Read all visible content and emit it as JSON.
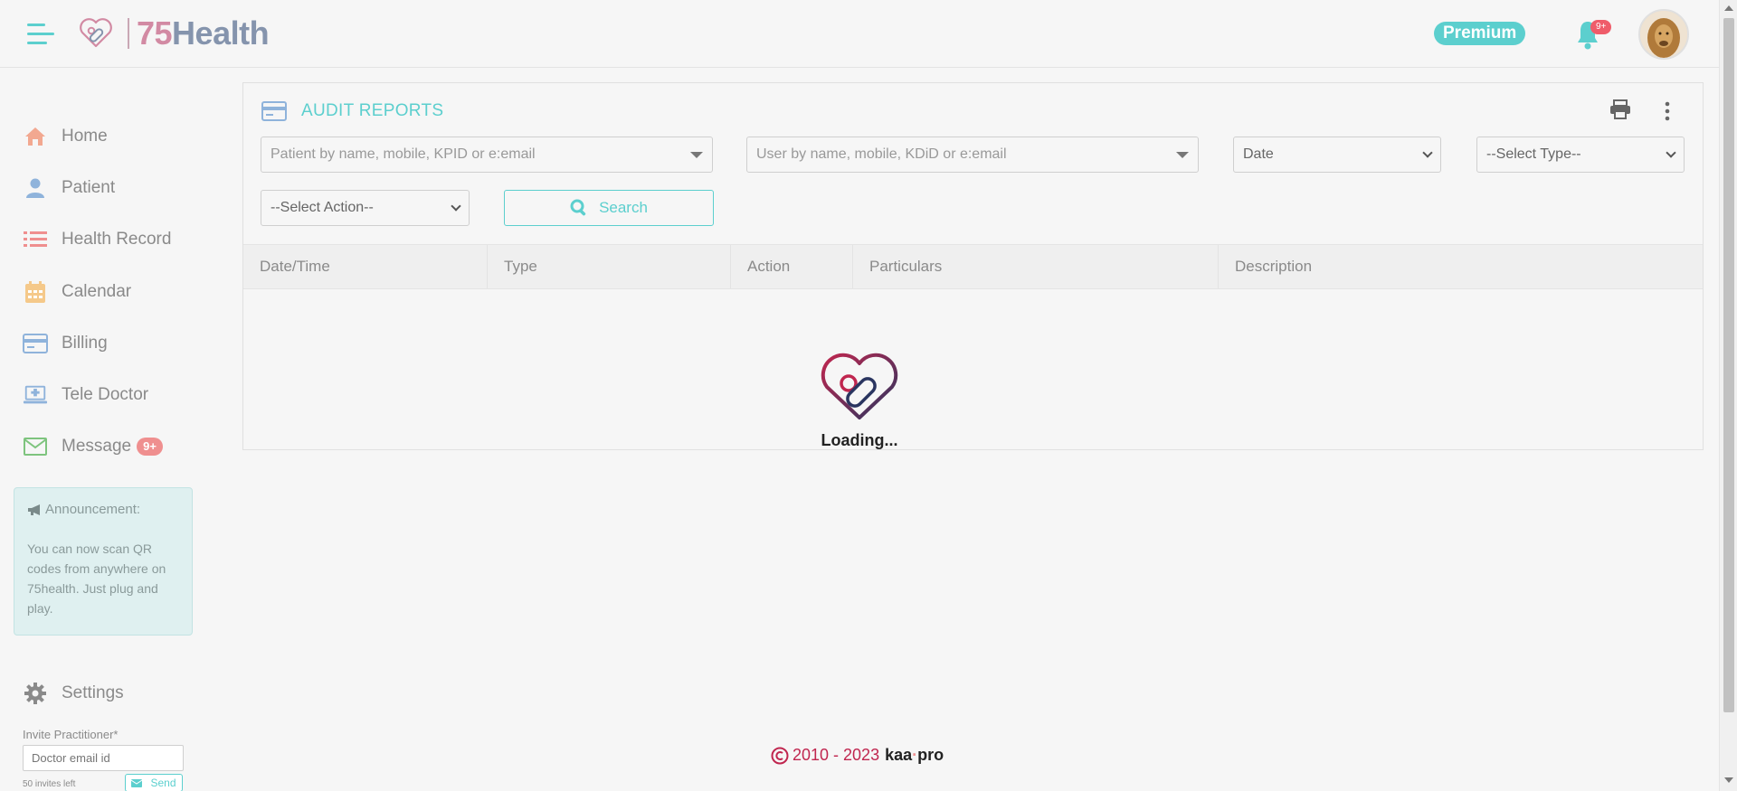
{
  "header": {
    "logo_number": "75",
    "logo_word": "Health",
    "premium_label": "Premium",
    "notification_badge": "9+"
  },
  "sidebar": {
    "items": [
      {
        "label": "Home",
        "icon": "home-icon"
      },
      {
        "label": "Patient",
        "icon": "user-icon"
      },
      {
        "label": "Health Record",
        "icon": "list-icon"
      },
      {
        "label": "Calendar",
        "icon": "calendar-icon"
      },
      {
        "label": "Billing",
        "icon": "credit-card-icon"
      },
      {
        "label": "Tele Doctor",
        "icon": "laptop-medical-icon"
      },
      {
        "label": "Message",
        "icon": "envelope-icon"
      }
    ],
    "message_badge": "9+",
    "announcement": {
      "title": "Announcement:",
      "body": "You can now scan QR codes from anywhere on 75health. Just plug and play."
    },
    "settings_label": "Settings",
    "invite": {
      "label": "Invite Practitioner*",
      "placeholder": "Doctor email id",
      "remaining": "50 invites left",
      "send_label": "Send"
    }
  },
  "main": {
    "title": "AUDIT REPORTS",
    "filters": {
      "patient_placeholder": "Patient by name, mobile, KPID or e:email",
      "user_placeholder": "User by name, mobile, KDiD or e:email",
      "date_value": "Date",
      "type_value": "--Select Type--",
      "action_value": "--Select Action--",
      "search_label": "Search"
    },
    "table": {
      "columns": [
        "Date/Time",
        "Type",
        "Action",
        "Particulars",
        "Description"
      ]
    },
    "loading_text": "Loading..."
  },
  "footer": {
    "years": "2010 - 2023",
    "brand_a": "kaa",
    "brand_b": "pro"
  },
  "colors": {
    "accent": "#5ccfce",
    "badge": "#ef5c6a",
    "brand_red": "#c0264f",
    "brand_navy": "#2a3560"
  }
}
